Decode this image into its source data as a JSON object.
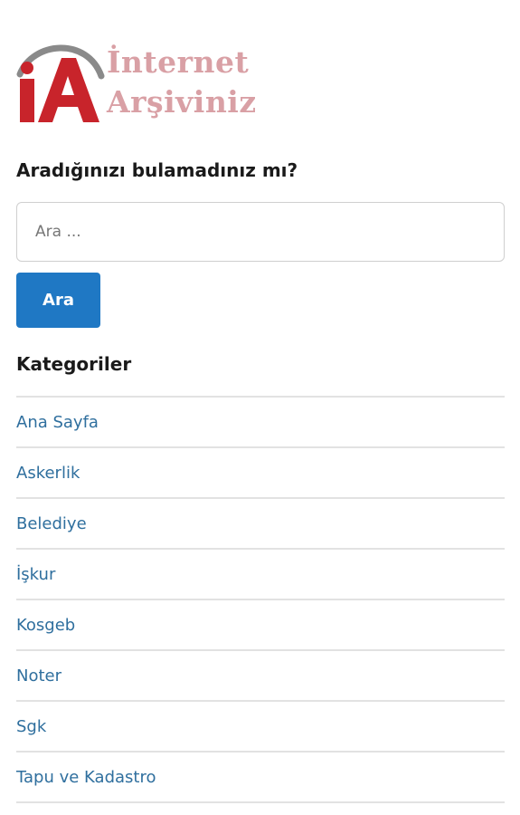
{
  "logo": {
    "mark_text": "iA",
    "line1": "İnternet",
    "line2": "Arşiviniz"
  },
  "search": {
    "heading": "Aradığınızı bulamadınız mı?",
    "placeholder": "Ara ...",
    "value": "",
    "button_label": "Ara"
  },
  "categories": {
    "heading": "Kategoriler",
    "items": [
      {
        "label": "Ana Sayfa"
      },
      {
        "label": "Askerlik"
      },
      {
        "label": "Belediye"
      },
      {
        "label": "İşkur"
      },
      {
        "label": "Kosgeb"
      },
      {
        "label": "Noter"
      },
      {
        "label": "Sgk"
      },
      {
        "label": "Tapu ve Kadastro"
      }
    ]
  },
  "colors": {
    "brand_red": "#c8242b",
    "brand_pink": "#d9a0a5",
    "arc_gray": "#8a8a8a",
    "button_blue": "#1f78c4",
    "link_blue": "#2f6f9e"
  }
}
